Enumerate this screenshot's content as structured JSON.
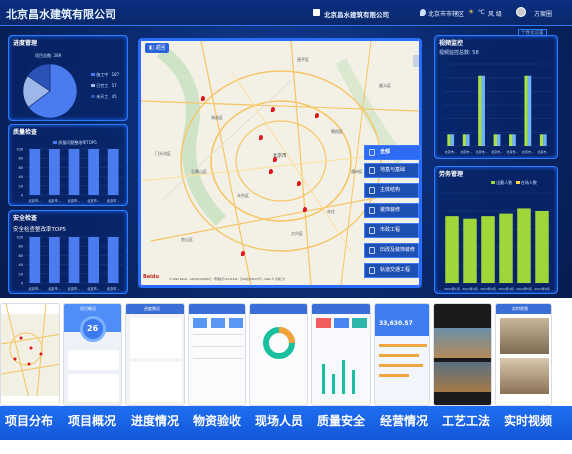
{
  "header": {
    "left_title": "北京昌水建筑有限公司",
    "center_title": "北京昌水建筑有限公司",
    "location": "北京市市辖区",
    "weather": "风 级",
    "user": "方案圈",
    "extra_link": "个性化设置"
  },
  "progress": {
    "title": "进度管理",
    "subtitle": "项目总数: 289",
    "legend": [
      "施工中",
      "已完工",
      "未开工"
    ],
    "legend_values": [
      "187",
      "57",
      "45"
    ],
    "chart_data": {
      "type": "pie",
      "categories": [
        "施工中",
        "已完工",
        "未开工"
      ],
      "values": [
        187,
        57,
        45
      ],
      "colors": [
        "#4a7cf0",
        "#9fb6e8",
        "#2d53b8"
      ]
    }
  },
  "quality": {
    "title": "质量检查",
    "legend": "质量问题整改率TOP5",
    "chart_data": {
      "type": "bar",
      "categories": [
        "北京市...",
        "北京市...",
        "北京市...",
        "北京市...",
        "北京市..."
      ],
      "values": [
        100,
        100,
        100,
        100,
        100
      ],
      "ylim": [
        0,
        100
      ],
      "yticks": [
        "100",
        "80",
        "60",
        "40",
        "20",
        "0"
      ]
    }
  },
  "safety": {
    "title": "安全检查",
    "subtitle": "安全检查整改率TOP5",
    "chart_data": {
      "type": "bar",
      "categories": [
        "北京市...",
        "北京市...",
        "北京市...",
        "北京市...",
        "北京市..."
      ],
      "values": [
        100,
        100,
        100,
        100,
        100
      ],
      "ylim": [
        0,
        100
      ],
      "yticks": [
        "100",
        "80",
        "60",
        "40",
        "20",
        "0"
      ]
    }
  },
  "map": {
    "back": "返回",
    "attribution": "© 2022 Baidu - GS(2021)6026号 - 甲测资字11111342 - 京ICP证030173号 - Data © 长地万方",
    "pins": [
      1,
      2,
      3,
      4,
      5,
      6,
      7,
      8,
      9
    ],
    "labels": [
      "昌平区",
      "顺义区",
      "海淀区",
      "朝阳区",
      "北京市",
      "通州区",
      "大兴区",
      "房山区",
      "丰台区",
      "石景山区",
      "门头沟区",
      "亦庄"
    ]
  },
  "categories": {
    "header": "全部",
    "items": [
      "地基与基础",
      "主体结构",
      "装饰装修",
      "市政工程",
      "旧改及装饰装修",
      "轨道交通工程"
    ]
  },
  "video": {
    "title": "视频监控",
    "subtitle": "视频监控总数: 58",
    "chart_data": {
      "type": "bar",
      "categories": [
        "北京市...",
        "北京市...",
        "北京市...",
        "北京市...",
        "北京市...",
        "北京市...",
        "北京市..."
      ],
      "series": [
        {
          "name": "",
          "values": [
            1,
            1,
            6,
            1,
            1,
            6,
            1
          ]
        },
        {
          "name": "",
          "values": [
            1,
            1,
            6,
            1,
            1,
            6,
            1
          ]
        }
      ],
      "ylim": [
        0,
        7
      ]
    }
  },
  "labor": {
    "title": "劳务管理",
    "legend": [
      "出勤人数",
      "在场人数"
    ],
    "chart_data": {
      "type": "bar",
      "categories": [
        "2022年1月",
        "2022年2月",
        "2022年3月",
        "2022年4月",
        "2022年5月",
        "2022年6月"
      ],
      "values": [
        2600,
        2500,
        2600,
        2700,
        2900,
        2800
      ],
      "ylim": [
        0,
        3500
      ]
    }
  },
  "tabs": [
    "项目分布",
    "项目概况",
    "进度情况",
    "物资验收",
    "现场人员",
    "质量安全",
    "经营情况",
    "工艺工法",
    "实时视频"
  ],
  "phones": {
    "p2": {
      "title": "项目概况",
      "num": "26"
    },
    "p3": {
      "title": "进度情况"
    },
    "p8": {
      "title": "经营情况",
      "num": "33,630.57"
    },
    "p9": {
      "title": "实时视频"
    }
  }
}
